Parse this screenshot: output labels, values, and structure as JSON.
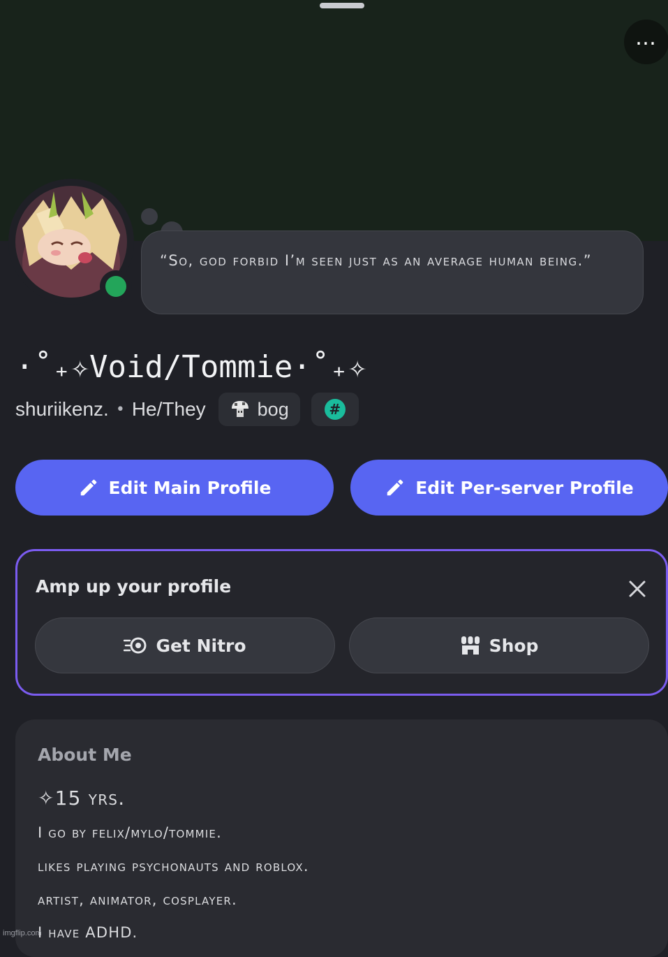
{
  "colors": {
    "background": "#1f2026",
    "banner": "#18231b",
    "accent": "#5865f2",
    "status_online": "#23a55a",
    "nitro_border": "#7b5cf0"
  },
  "profile": {
    "custom_status": "“So, god forbid I’m seen just as an average human being.”",
    "display_name": "·˚₊✧Void/Tommie·˚₊✧",
    "username": "shuriikenz.",
    "separator": "•",
    "pronouns": "He/They",
    "tag_label": "bog",
    "status": "online"
  },
  "icons": {
    "more": "more-options-icon",
    "edit": "pencil-icon",
    "close": "close-icon",
    "nitro": "nitro-icon",
    "shop": "shop-icon",
    "hash": "hashtag-badge-icon",
    "tag": "mushroom-icon"
  },
  "buttons": {
    "edit_main": "Edit Main Profile",
    "edit_server": "Edit Per-server Profile"
  },
  "amp": {
    "title": "Amp up your profile",
    "get_nitro": "Get Nitro",
    "shop": "Shop"
  },
  "about": {
    "title": "About Me",
    "lines": [
      "✧15 yrs.",
      "I go by felix/mylo/tommie.",
      "likes playing psychonauts and roblox.",
      "artist, animator, cosplayer.",
      "I have ADHD."
    ]
  },
  "watermark": "imgflip.com"
}
